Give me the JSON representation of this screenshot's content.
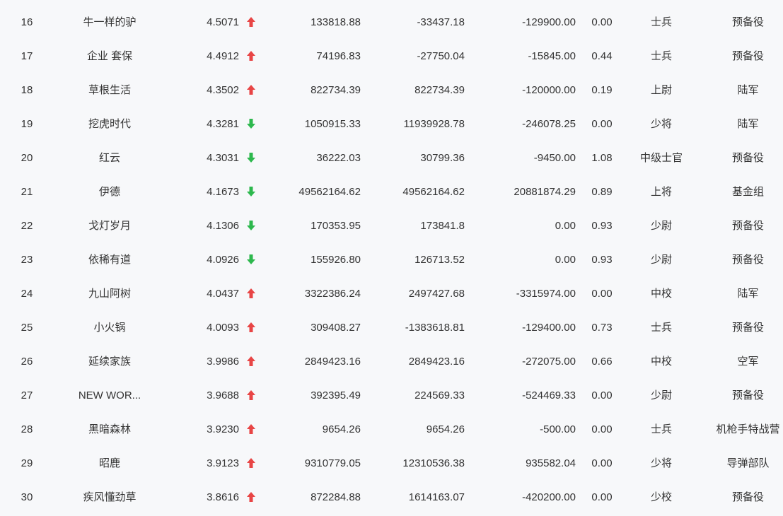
{
  "colors": {
    "up": "#e84545",
    "down": "#2db84d",
    "text": "#333333",
    "background": "#f7f8fa"
  },
  "rows": [
    {
      "rank": "16",
      "name": "牛一样的驴",
      "score": "4.5071",
      "trend": "up",
      "v1": "133818.88",
      "v2": "-33437.18",
      "v3": "-129900.00",
      "ratio": "0.00",
      "title": "士兵",
      "group": "预备役"
    },
    {
      "rank": "17",
      "name": "企业 套保",
      "score": "4.4912",
      "trend": "up",
      "v1": "74196.83",
      "v2": "-27750.04",
      "v3": "-15845.00",
      "ratio": "0.44",
      "title": "士兵",
      "group": "预备役"
    },
    {
      "rank": "18",
      "name": "草根生活",
      "score": "4.3502",
      "trend": "up",
      "v1": "822734.39",
      "v2": "822734.39",
      "v3": "-120000.00",
      "ratio": "0.19",
      "title": "上尉",
      "group": "陆军"
    },
    {
      "rank": "19",
      "name": "挖虎时代",
      "score": "4.3281",
      "trend": "down",
      "v1": "1050915.33",
      "v2": "11939928.78",
      "v3": "-246078.25",
      "ratio": "0.00",
      "title": "少将",
      "group": "陆军"
    },
    {
      "rank": "20",
      "name": "红云",
      "score": "4.3031",
      "trend": "down",
      "v1": "36222.03",
      "v2": "30799.36",
      "v3": "-9450.00",
      "ratio": "1.08",
      "title": "中级士官",
      "group": "预备役"
    },
    {
      "rank": "21",
      "name": "伊德",
      "score": "4.1673",
      "trend": "down",
      "v1": "49562164.62",
      "v2": "49562164.62",
      "v3": "20881874.29",
      "ratio": "0.89",
      "title": "上将",
      "group": "基金组"
    },
    {
      "rank": "22",
      "name": "戈灯岁月",
      "score": "4.1306",
      "trend": "down",
      "v1": "170353.95",
      "v2": "173841.8",
      "v3": "0.00",
      "ratio": "0.93",
      "title": "少尉",
      "group": "预备役"
    },
    {
      "rank": "23",
      "name": "依稀有道",
      "score": "4.0926",
      "trend": "down",
      "v1": "155926.80",
      "v2": "126713.52",
      "v3": "0.00",
      "ratio": "0.93",
      "title": "少尉",
      "group": "预备役"
    },
    {
      "rank": "24",
      "name": "九山阿树",
      "score": "4.0437",
      "trend": "up",
      "v1": "3322386.24",
      "v2": "2497427.68",
      "v3": "-3315974.00",
      "ratio": "0.00",
      "title": "中校",
      "group": "陆军"
    },
    {
      "rank": "25",
      "name": "小火锅",
      "score": "4.0093",
      "trend": "up",
      "v1": "309408.27",
      "v2": "-1383618.81",
      "v3": "-129400.00",
      "ratio": "0.73",
      "title": "士兵",
      "group": "预备役"
    },
    {
      "rank": "26",
      "name": "延续家族",
      "score": "3.9986",
      "trend": "up",
      "v1": "2849423.16",
      "v2": "2849423.16",
      "v3": "-272075.00",
      "ratio": "0.66",
      "title": "中校",
      "group": "空军"
    },
    {
      "rank": "27",
      "name": "NEW WOR...",
      "score": "3.9688",
      "trend": "up",
      "v1": "392395.49",
      "v2": "224569.33",
      "v3": "-524469.33",
      "ratio": "0.00",
      "title": "少尉",
      "group": "预备役"
    },
    {
      "rank": "28",
      "name": "黑暗森林",
      "score": "3.9230",
      "trend": "up",
      "v1": "9654.26",
      "v2": "9654.26",
      "v3": "-500.00",
      "ratio": "0.00",
      "title": "士兵",
      "group": "机枪手特战营"
    },
    {
      "rank": "29",
      "name": "昭鹿",
      "score": "3.9123",
      "trend": "up",
      "v1": "9310779.05",
      "v2": "12310536.38",
      "v3": "935582.04",
      "ratio": "0.00",
      "title": "少将",
      "group": "导弹部队"
    },
    {
      "rank": "30",
      "name": "疾风懂劲草",
      "score": "3.8616",
      "trend": "up",
      "v1": "872284.88",
      "v2": "1614163.07",
      "v3": "-420200.00",
      "ratio": "0.00",
      "title": "少校",
      "group": "预备役"
    }
  ]
}
